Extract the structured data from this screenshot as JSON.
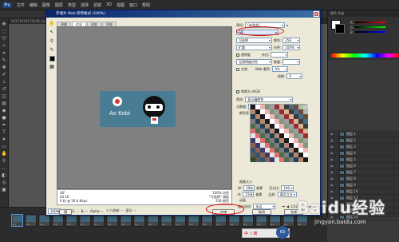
{
  "ps": {
    "logo": "Ps",
    "menu": [
      "文件",
      "编辑",
      "图像",
      "图层",
      "类型",
      "选择",
      "滤镜",
      "3D",
      "视图",
      "窗口",
      "帮助"
    ],
    "doc_tab": "20121030135438_f.psd @ 100%"
  },
  "dialog": {
    "title": "存储为 Web 所用格式 (100%)",
    "close": "x",
    "tabs": [
      "原稿",
      "优化",
      "双联",
      "四联"
    ],
    "active_tab": "优化",
    "preview_info_left": [
      "GIF",
      "44.1K",
      "9 秒 @ 56.6 Kbps"
    ],
    "preview_info_right": [
      "100% 仿色",
      "\"可选择\" 调板",
      "256 颜色"
    ],
    "preview_art": {
      "logo_text": "Ao Kobi"
    },
    "bottom": {
      "zoom": "100%",
      "r": "R: --",
      "g": "G: --",
      "b": "B: --",
      "alpha": "Alpha: --",
      "hex": "十六进制: --",
      "index": "索引: --",
      "preview_btn": "预览...",
      "save_btn": "存储",
      "cancel_btn": "取消",
      "done_btn": "完成"
    },
    "settings": {
      "preset_label": "预设:",
      "preset_value": "[未命名]",
      "format": "GIF",
      "reduction": "可选择",
      "colors_label": "颜色:",
      "colors_value": "256",
      "dither_algo": "扩散",
      "dither_label": "仿色:",
      "dither_value": "100%",
      "transparency": "透明度",
      "matte_label": "杂边:",
      "trans_dither": "无透明度仿色",
      "amount_label": "数量:",
      "interlaced": "交错",
      "web_snap_label": "Web 靠色:",
      "web_snap_value": "0%",
      "lossy_label": "损耗:",
      "lossy_value": "0",
      "convert_srgb": "转换为 sRGB",
      "preview_label": "预览:",
      "preview_value": "显示器颜色",
      "metadata_label": "元数据:",
      "metadata_value": "版权和联系信息",
      "color_table_label": "颜色表",
      "image_size_label": "图像大小",
      "w_label": "W:",
      "w_value": "300",
      "h_label": "H:",
      "h_value": "150",
      "w_unit": "像素",
      "h_unit": "像素",
      "percent_label": "百分比:",
      "percent_value": "100",
      "quality_label": "品质:",
      "quality_value": "两次立方",
      "animation_label": "动画",
      "loop_label": "循环选项:",
      "loop_value": "永远",
      "frame_counter": "1/32"
    }
  },
  "layers": [
    "图层 1",
    "图层 2",
    "图层 3",
    "图层 4",
    "图层 5",
    "图层 6",
    "图层 7",
    "图层 8",
    "图层 9",
    "图层 10",
    "图层 11",
    "图层 12",
    "图层 13",
    "图层 14"
  ],
  "timeline": {
    "frames": [
      "0.1",
      "0.1",
      "0.1",
      "0.1",
      "0.1",
      "0.1",
      "0.1",
      "0.1",
      "0.1",
      "0.1",
      "0.1",
      "0.1",
      "0.1",
      "0.1",
      "0.1",
      "0.1",
      "0.1",
      "0.1",
      "0.1",
      "0.1",
      "0.1",
      "0.1"
    ],
    "loop": "永远"
  },
  "tray": {
    "text": "中 ♪ 简",
    "bubble": "63"
  },
  "watermark": {
    "main": "Baidu经验",
    "sub": "jingyan.baidu.com"
  },
  "colors": {
    "ps_dark": "#2b2b2b",
    "dialog_bg": "#ece9d8",
    "xp_title": "#0a246a",
    "highlight": "#d00000"
  }
}
